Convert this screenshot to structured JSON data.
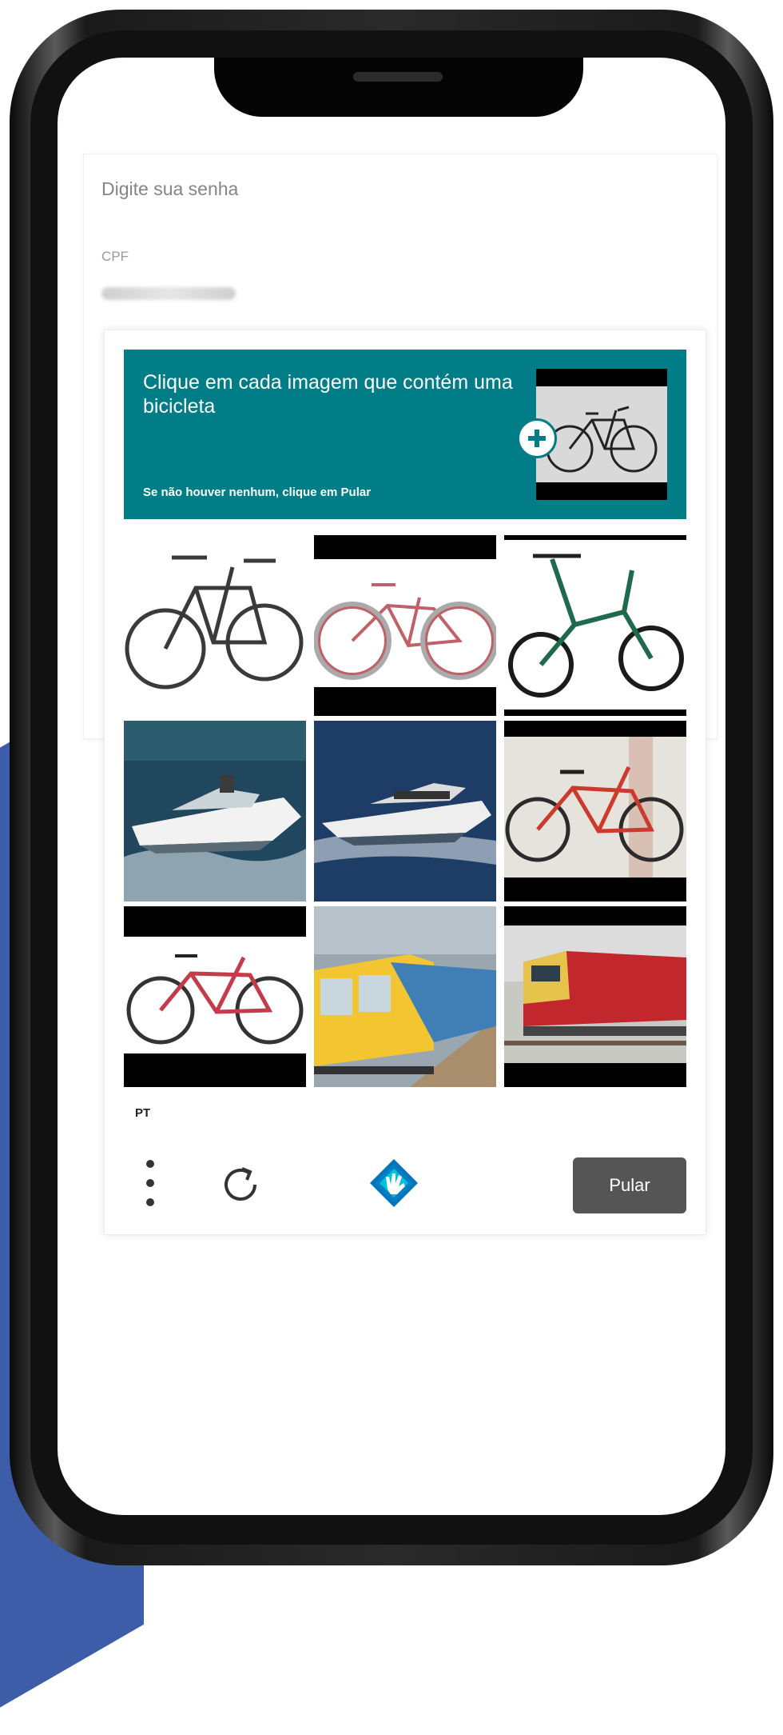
{
  "login_card": {
    "title": "Digite sua senha",
    "cpf_label": "CPF"
  },
  "captcha": {
    "prompt": "Clique em cada imagem que contém uma bicicleta",
    "subprompt": "Se não houver nenhum, clique em Pular",
    "tiles": [
      {
        "content": "bicycle",
        "selected": false
      },
      {
        "content": "bicycle",
        "selected": false
      },
      {
        "content": "bicycle",
        "selected": false
      },
      {
        "content": "boat",
        "selected": false
      },
      {
        "content": "boat",
        "selected": false
      },
      {
        "content": "bicycle",
        "selected": false
      },
      {
        "content": "bicycle",
        "selected": false
      },
      {
        "content": "train",
        "selected": false
      },
      {
        "content": "train",
        "selected": false
      }
    ],
    "language": "PT",
    "skip_label": "Pular",
    "accent_color": "#017d87"
  },
  "colors": {
    "banner": "#017d87",
    "skip_button": "#555555",
    "background_shape": "#3d5da8"
  }
}
